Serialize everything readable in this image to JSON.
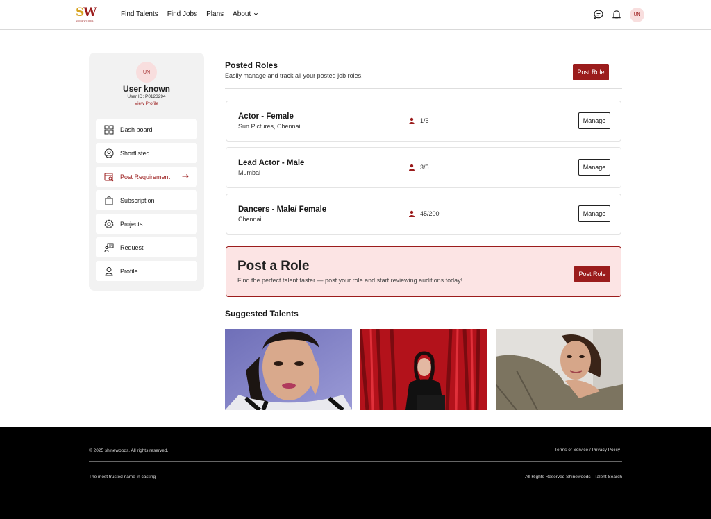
{
  "header": {
    "logo_text_s": "S",
    "logo_text_w": "W",
    "logo_tagline": "SHINEWOODS",
    "nav": [
      "Find Talents",
      "Find Jobs",
      "Plans",
      "About"
    ],
    "avatar_initials": "UN"
  },
  "sidebar": {
    "avatar_initials": "UN",
    "user_name": "User known",
    "user_id": "User ID: P0123294",
    "view_profile": "View Profile",
    "items": [
      {
        "label": "Dash board",
        "icon": "dashboard-icon"
      },
      {
        "label": "Shortlisted",
        "icon": "user-circle-icon"
      },
      {
        "label": "Post Requirement",
        "icon": "post-requirement-icon",
        "active": true
      },
      {
        "label": "Subscription",
        "icon": "bag-icon"
      },
      {
        "label": "Projects",
        "icon": "gear-icon"
      },
      {
        "label": "Request",
        "icon": "request-icon"
      },
      {
        "label": "Profile",
        "icon": "profile-icon"
      }
    ]
  },
  "posted_roles": {
    "title": "Posted Roles",
    "subtitle": "Easily manage and track all your posted job roles.",
    "post_role_label": "Post Role",
    "roles": [
      {
        "title": "Actor - Female",
        "location": "Sun Pictures, Chennai",
        "count": "1/5",
        "manage_label": "Manage"
      },
      {
        "title": "Lead Actor - Male",
        "location": "Mumbai",
        "count": "3/5",
        "manage_label": "Manage"
      },
      {
        "title": "Dancers - Male/ Female",
        "location": "Chennai",
        "count": "45/200",
        "manage_label": "Manage"
      }
    ]
  },
  "banner": {
    "title": "Post a Role",
    "subtitle": "Find the perfect talent faster — post your role and start reviewing auditions today!",
    "button_label": "Post Role"
  },
  "suggested": {
    "title": "Suggested Talents"
  },
  "footer": {
    "copyright": "© 2025 shinewoods. All rights reserved.",
    "links": "Terms of Service / Privacy Policy",
    "tagline": "The most trusted name in casting",
    "rights": "All Rights Reserved Shinewoods - Talent Search"
  },
  "colors": {
    "brand": "#9b1c1c",
    "banner_bg": "#fce4e4",
    "sidebar_bg": "#f2f2f2"
  }
}
